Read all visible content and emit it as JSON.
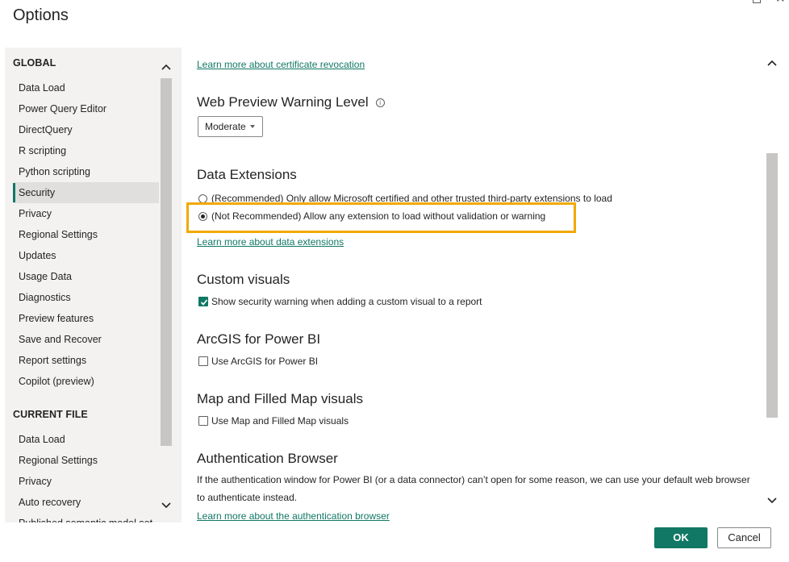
{
  "window": {
    "title": "Options",
    "restore_icon": "restore-icon",
    "close_icon": "close-icon",
    "close_glyph": "✕"
  },
  "sidebar": {
    "global_header": "GLOBAL",
    "global_items": [
      {
        "label": "Data Load"
      },
      {
        "label": "Power Query Editor"
      },
      {
        "label": "DirectQuery"
      },
      {
        "label": "R scripting"
      },
      {
        "label": "Python scripting"
      },
      {
        "label": "Security",
        "selected": true
      },
      {
        "label": "Privacy"
      },
      {
        "label": "Regional Settings"
      },
      {
        "label": "Updates"
      },
      {
        "label": "Usage Data"
      },
      {
        "label": "Diagnostics"
      },
      {
        "label": "Preview features"
      },
      {
        "label": "Save and Recover"
      },
      {
        "label": "Report settings"
      },
      {
        "label": "Copilot (preview)"
      }
    ],
    "current_file_header": "CURRENT FILE",
    "current_file_items": [
      {
        "label": "Data Load"
      },
      {
        "label": "Regional Settings"
      },
      {
        "label": "Privacy"
      },
      {
        "label": "Auto recovery"
      },
      {
        "label": "Published semantic model set"
      }
    ]
  },
  "main": {
    "cert_link": "Learn more about certificate revocation",
    "web_preview": {
      "heading": "Web Preview Warning Level",
      "info_glyph": "i",
      "dropdown_value": "Moderate"
    },
    "data_extensions": {
      "heading": "Data Extensions",
      "option_recommended": "(Recommended) Only allow Microsoft certified and other trusted third-party extensions to load",
      "option_not_recommended": "(Not Recommended) Allow any extension to load without validation or warning",
      "selected": "not_recommended",
      "link": "Learn more about data extensions",
      "highlight_color": "#f2a900"
    },
    "custom_visuals": {
      "heading": "Custom visuals",
      "checkbox_label": "Show security warning when adding a custom visual to a report",
      "checked": true
    },
    "arcgis": {
      "heading": "ArcGIS for Power BI",
      "checkbox_label": "Use ArcGIS for Power BI",
      "checked": false
    },
    "map_visuals": {
      "heading": "Map and Filled Map visuals",
      "checkbox_label": "Use Map and Filled Map visuals",
      "checked": false
    },
    "auth_browser": {
      "heading": "Authentication Browser",
      "description": "If the authentication window for Power BI (or a data connector) can’t open for some reason, we can use your default web browser to authenticate instead.",
      "link": "Learn more about the authentication browser"
    }
  },
  "footer": {
    "ok_label": "OK",
    "cancel_label": "Cancel"
  },
  "colors": {
    "accent": "#117865",
    "highlight": "#f2a900"
  }
}
